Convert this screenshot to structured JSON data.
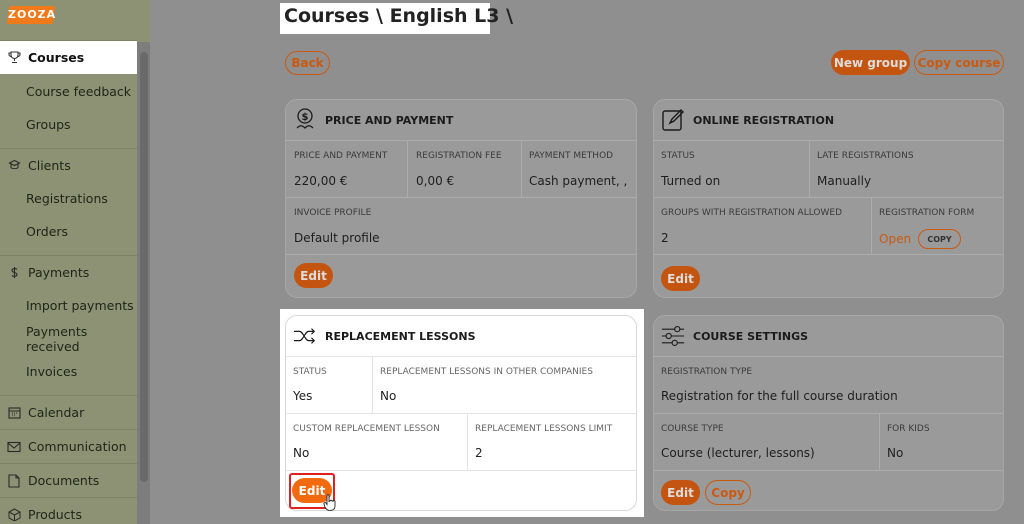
{
  "app": {
    "logo_text": "ZOOZA",
    "page_title": "Courses \\ English L3 \\"
  },
  "colors": {
    "accent": "#f26a10",
    "sidebar": "#8d9274",
    "overlay": "#8f8f8f"
  },
  "sidebar": {
    "items": [
      {
        "label": "Courses",
        "icon": "trophy-icon",
        "active": true
      },
      {
        "label": "Course feedback"
      },
      {
        "label": "Groups"
      },
      {
        "label": "Clients",
        "icon": "users-icon"
      },
      {
        "label": "Registrations"
      },
      {
        "label": "Orders"
      },
      {
        "label": "Payments",
        "icon": "dollar-icon"
      },
      {
        "label": "Import payments"
      },
      {
        "label": "Payments received"
      },
      {
        "label": "Invoices"
      },
      {
        "label": "Calendar",
        "icon": "calendar-icon"
      },
      {
        "label": "Communication",
        "icon": "mail-icon"
      },
      {
        "label": "Documents",
        "icon": "document-icon"
      },
      {
        "label": "Products",
        "icon": "box-icon"
      }
    ]
  },
  "toolbar": {
    "back": "Back",
    "new_group": "New group",
    "copy_course": "Copy course"
  },
  "price_card": {
    "title": "PRICE AND PAYMENT",
    "col1_label": "PRICE AND PAYMENT",
    "col1_value": "220,00 €",
    "col2_label": "REGISTRATION FEE",
    "col2_value": "0,00 €",
    "col3_label": "PAYMENT METHOD",
    "col3_value": "Cash payment, ,",
    "invoice_label": "INVOICE PROFILE",
    "invoice_value": "Default profile",
    "edit": "Edit"
  },
  "online_card": {
    "title": "ONLINE REGISTRATION",
    "status_label": "STATUS",
    "status_value": "Turned on",
    "late_label": "LATE REGISTRATIONS",
    "late_value": "Manually",
    "groups_label": "GROUPS WITH REGISTRATION ALLOWED",
    "groups_value": "2",
    "form_label": "REGISTRATION FORM",
    "form_open": "Open",
    "form_copy": "COPY",
    "edit": "Edit"
  },
  "replacement_card": {
    "title": "REPLACEMENT LESSONS",
    "status_label": "STATUS",
    "status_value": "Yes",
    "other_label": "REPLACEMENT LESSONS IN OTHER COMPANIES",
    "other_value": "No",
    "custom_label": "CUSTOM REPLACEMENT LESSON",
    "custom_value": "No",
    "limit_label": "REPLACEMENT LESSONS LIMIT",
    "limit_value": "2",
    "edit": "Edit"
  },
  "settings_card": {
    "title": "COURSE SETTINGS",
    "reg_type_label": "REGISTRATION TYPE",
    "reg_type_value": "Registration for the full course duration",
    "course_type_label": "COURSE TYPE",
    "course_type_value": "Course (lecturer, lessons)",
    "kids_label": "FOR KIDS",
    "kids_value": "No",
    "edit": "Edit",
    "copy": "Copy"
  }
}
